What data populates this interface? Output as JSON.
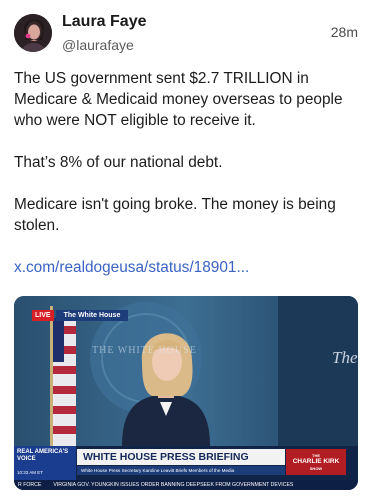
{
  "post": {
    "author_name": "Laura Faye",
    "author_handle": "@laurafaye",
    "timestamp": "28m",
    "paragraphs": [
      "The US government sent $2.7 TRILLION in Medicare & Medicaid money overseas to people who were NOT eligible to receive it.",
      "That’s 8% of our national debt.",
      "Medicare isn't going broke. The money is being stolen."
    ],
    "link_text": "x.com/realdogeusa/status/18901..."
  },
  "video": {
    "live_label": "LIVE",
    "network_label": "The White House",
    "seal_text": "THE WHITE HOUSE",
    "sign_text": "The",
    "logo_text": "REAL AMERICA'S VOICE",
    "clock_text": "10:33 AM ET",
    "banner_title": "WHITE HOUSE PRESS BRIEFING",
    "banner_subtitle": "White House Press Secretary Karoline Leavitt Briefs Members of the Media",
    "corner_logo_top": "THE",
    "corner_logo_main": "CHARLIE KIRK",
    "corner_logo_bottom": "SHOW",
    "ticker_label": "R FORCE",
    "ticker_text": "VIRGINIA GOV. YOUNGKIN ISSUES ORDER BANNING DEEPSEEK FROM GOVERNMENT DEVICES"
  }
}
